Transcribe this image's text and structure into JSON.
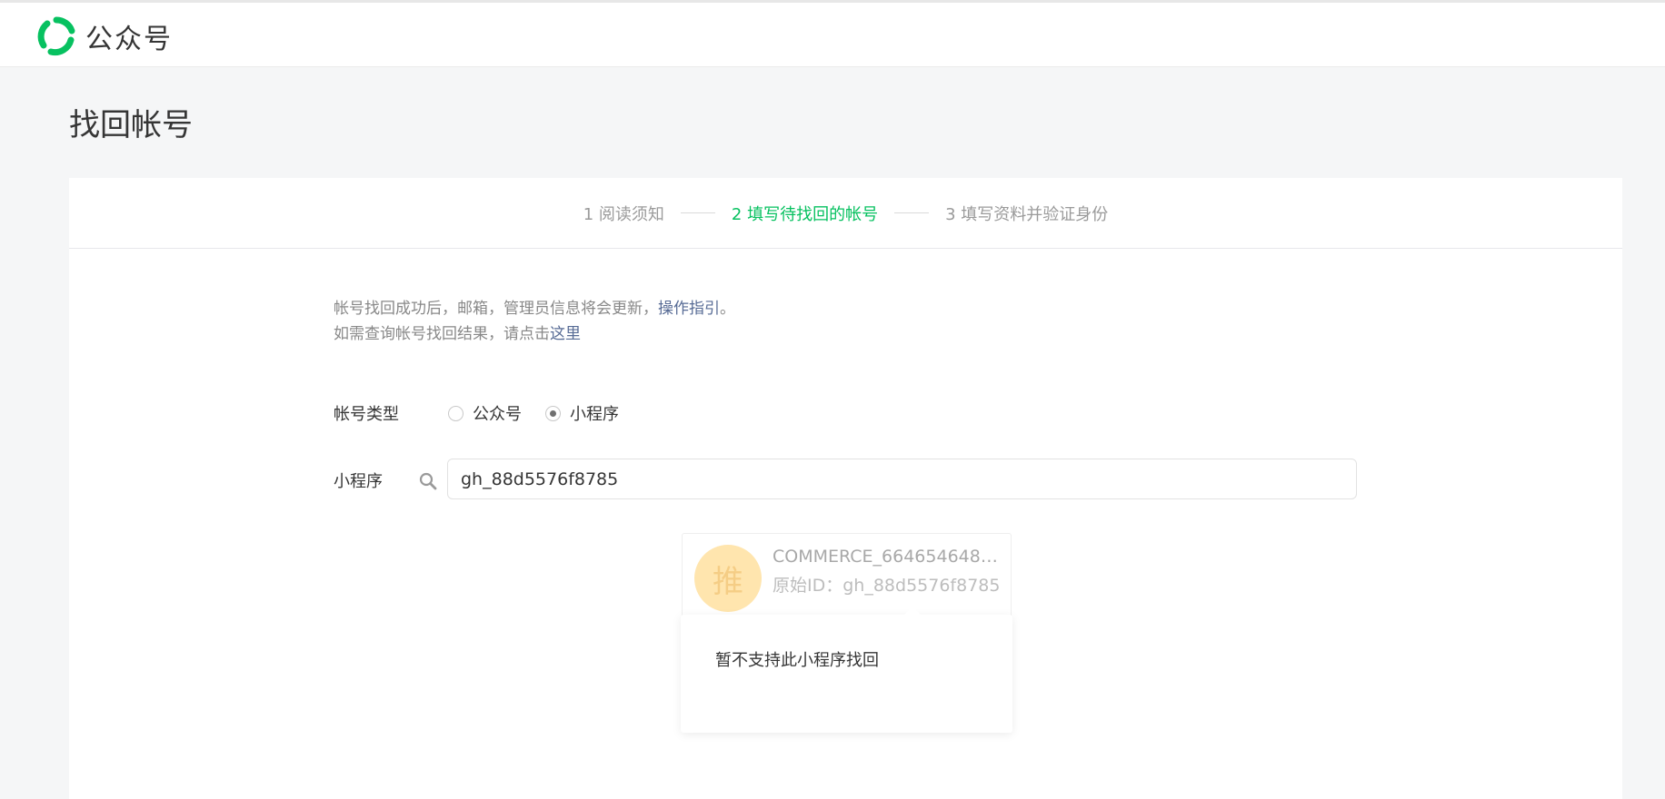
{
  "header": {
    "logo_text": "公众号",
    "brand_color": "#07c160"
  },
  "page": {
    "title": "找回帐号"
  },
  "steps": [
    {
      "label": "1 阅读须知",
      "active": false
    },
    {
      "label": "2 填写待找回的帐号",
      "active": true
    },
    {
      "label": "3 填写资料并验证身份",
      "active": false
    }
  ],
  "notice": {
    "line1_text": "帐号找回成功后，邮箱，管理员信息将会更新，",
    "line1_link": "操作指引",
    "line1_end": "。",
    "line2_text": "如需查询帐号找回结果，请点击",
    "line2_link": "这里"
  },
  "account_type": {
    "label": "帐号类型",
    "options": [
      {
        "label": "公众号",
        "checked": false
      },
      {
        "label": "小程序",
        "checked": true
      }
    ]
  },
  "search": {
    "label": "小程序",
    "value": "gh_88d5576f8785",
    "icon": "search-icon"
  },
  "result": {
    "avatar_char": "推",
    "name": "COMMERCE_6646546488...",
    "id_line": "原始ID：gh_88d5576f8785"
  },
  "popover": {
    "message": "暂不支持此小程序找回"
  }
}
